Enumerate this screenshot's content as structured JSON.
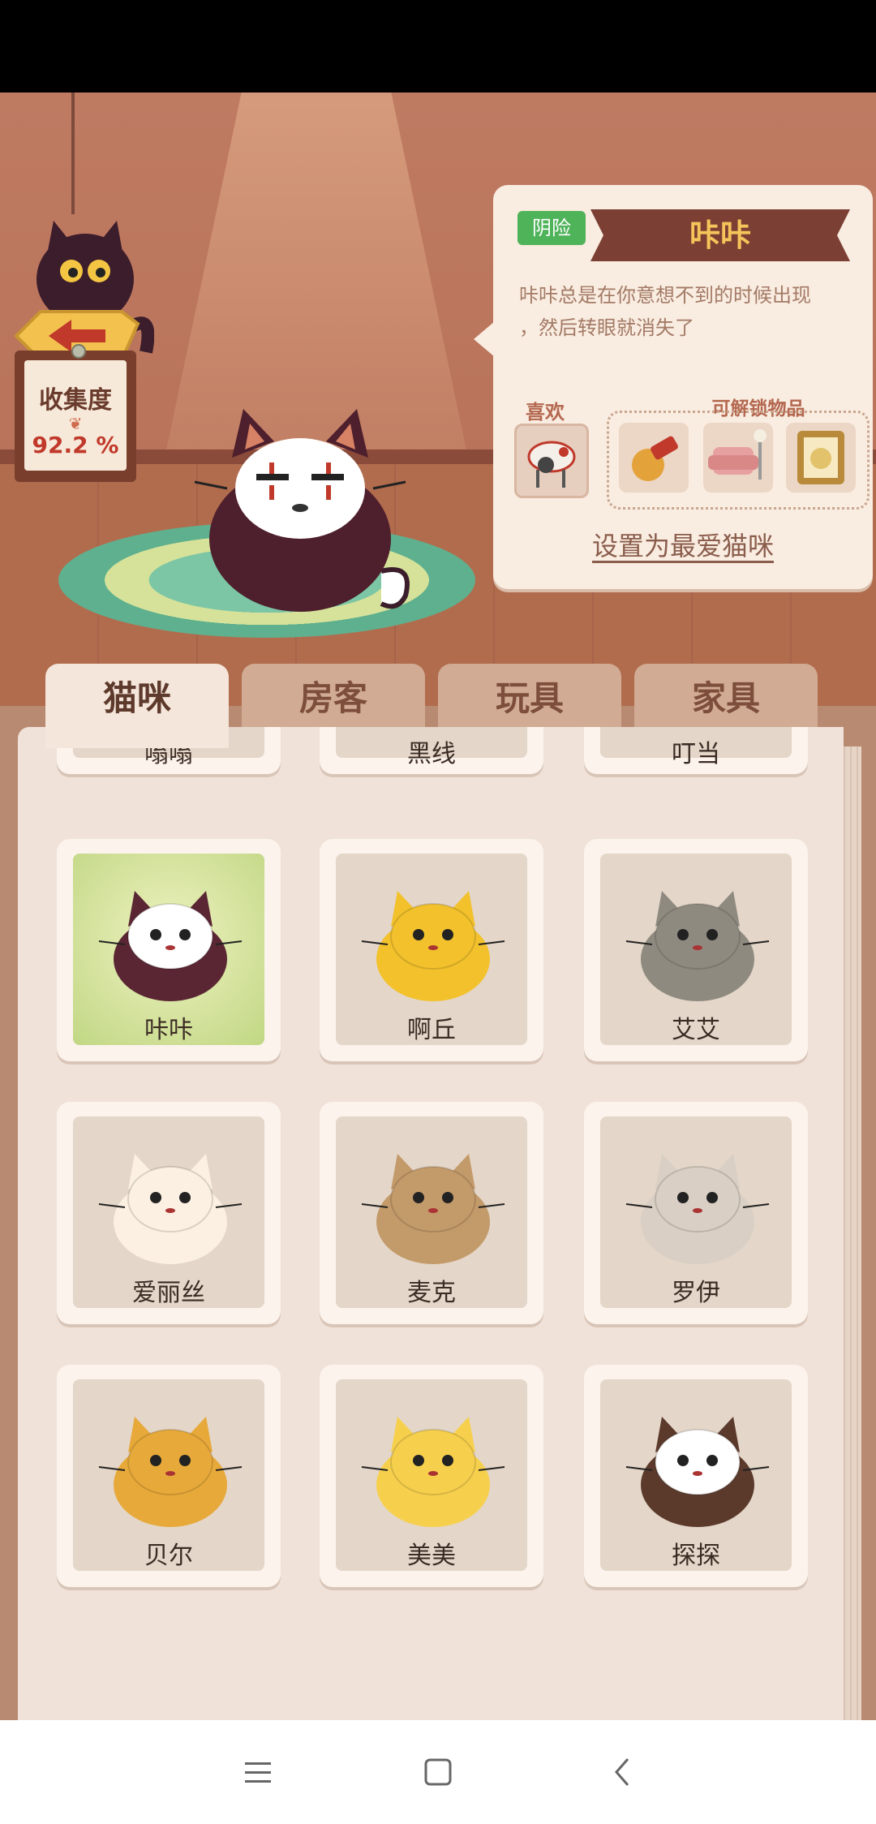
{
  "scene": {
    "collection": {
      "title": "收集度",
      "value": "92.2 %"
    }
  },
  "info": {
    "type_badge": "阴险",
    "name": "咔咔",
    "description_line1": "咔咔总是在你意想不到的时候出现",
    "description_line2": "，然后转眼就消失了",
    "like_label": "喜欢",
    "unlock_label": "可解锁物品",
    "set_favorite": "设置为最爱猫咪"
  },
  "tabs": [
    {
      "label": "猫咪",
      "active": true
    },
    {
      "label": "房客",
      "active": false
    },
    {
      "label": "玩具",
      "active": false
    },
    {
      "label": "家具",
      "active": false
    }
  ],
  "partial_row": [
    "嗡嗡",
    "黑线",
    "叮当"
  ],
  "cats": [
    {
      "name": "咔咔",
      "selected": true,
      "color": "#5a2633"
    },
    {
      "name": "啊丘",
      "selected": false,
      "color": "#f2c12c"
    },
    {
      "name": "艾艾",
      "selected": false,
      "color": "#8f8a80"
    },
    {
      "name": "爱丽丝",
      "selected": false,
      "color": "#fbf0e2"
    },
    {
      "name": "麦克",
      "selected": false,
      "color": "#c39a6a"
    },
    {
      "name": "罗伊",
      "selected": false,
      "color": "#d9cfc4"
    },
    {
      "name": "贝尔",
      "selected": false,
      "color": "#e7a93a"
    },
    {
      "name": "美美",
      "selected": false,
      "color": "#f6d04d"
    },
    {
      "name": "探探",
      "selected": false,
      "color": "#5b3a2c"
    }
  ],
  "nav": {
    "menu_icon": "menu-icon",
    "home_icon": "home-icon",
    "back_icon": "back-icon"
  }
}
